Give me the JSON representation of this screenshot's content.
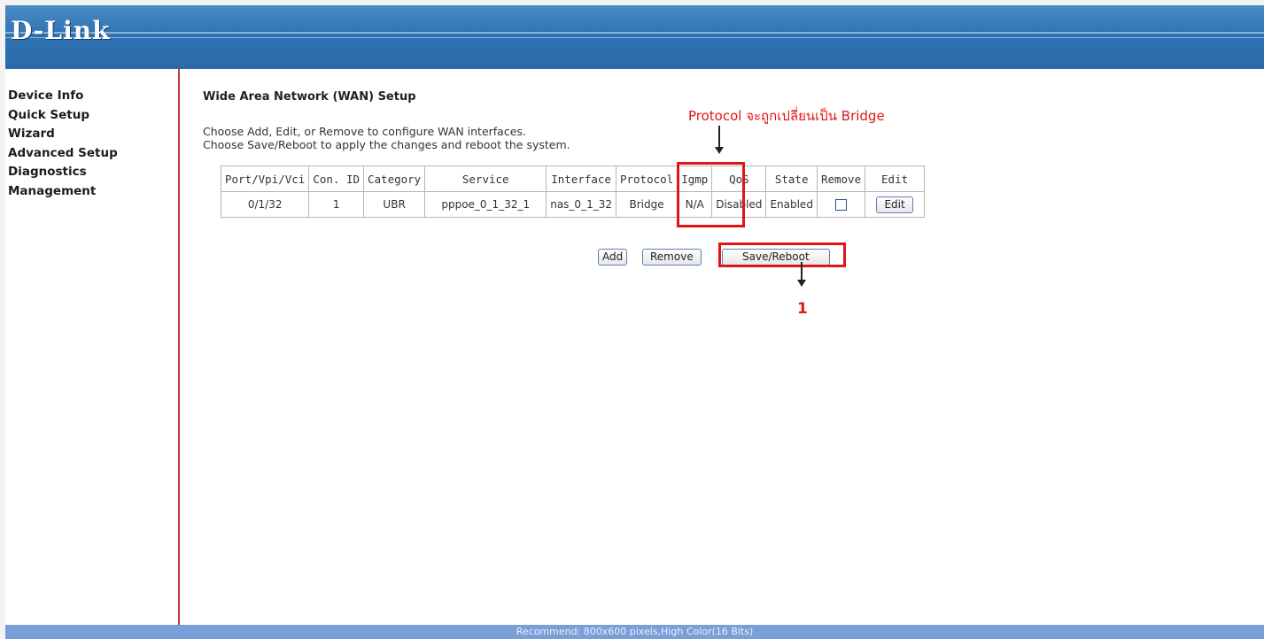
{
  "header": {
    "logo": "D-Link"
  },
  "sidebar": {
    "items": [
      {
        "label": "Device Info"
      },
      {
        "label": "Quick Setup"
      },
      {
        "label": "Wizard"
      },
      {
        "label": "Advanced Setup"
      },
      {
        "label": "Diagnostics"
      },
      {
        "label": "Management"
      }
    ]
  },
  "main": {
    "title": "Wide Area Network (WAN) Setup",
    "desc_line1": "Choose Add, Edit, or Remove to configure WAN interfaces.",
    "desc_line2": "Choose Save/Reboot to apply the changes and reboot the system.",
    "table": {
      "headers": [
        "Port/Vpi/Vci",
        "Con. ID",
        "Category",
        "Service",
        "Interface",
        "Protocol",
        "Igmp",
        "QoS",
        "State",
        "Remove",
        "Edit"
      ],
      "rows": [
        {
          "port": "0/1/32",
          "con_id": "1",
          "category": "UBR",
          "service": "pppoe_0_1_32_1",
          "interface": "nas_0_1_32",
          "protocol": "Bridge",
          "igmp": "N/A",
          "qos": "Disabled",
          "state": "Enabled",
          "remove_checked": false,
          "edit_label": "Edit"
        }
      ]
    },
    "buttons": {
      "add": "Add",
      "remove": "Remove",
      "save_reboot": "Save/Reboot"
    }
  },
  "annotations": {
    "protocol_note": "Protocol จะถูกเปลี่ยนเป็น Bridge",
    "step_number": "1",
    "color": "#e21515"
  },
  "footer": {
    "text": "Recommend: 800x600 pixels,High Color(16 Bits)"
  },
  "colors": {
    "header_blue": "#2f73b5",
    "sidebar_border": "#c43a3a",
    "footer_blue": "#7a9fd8"
  }
}
